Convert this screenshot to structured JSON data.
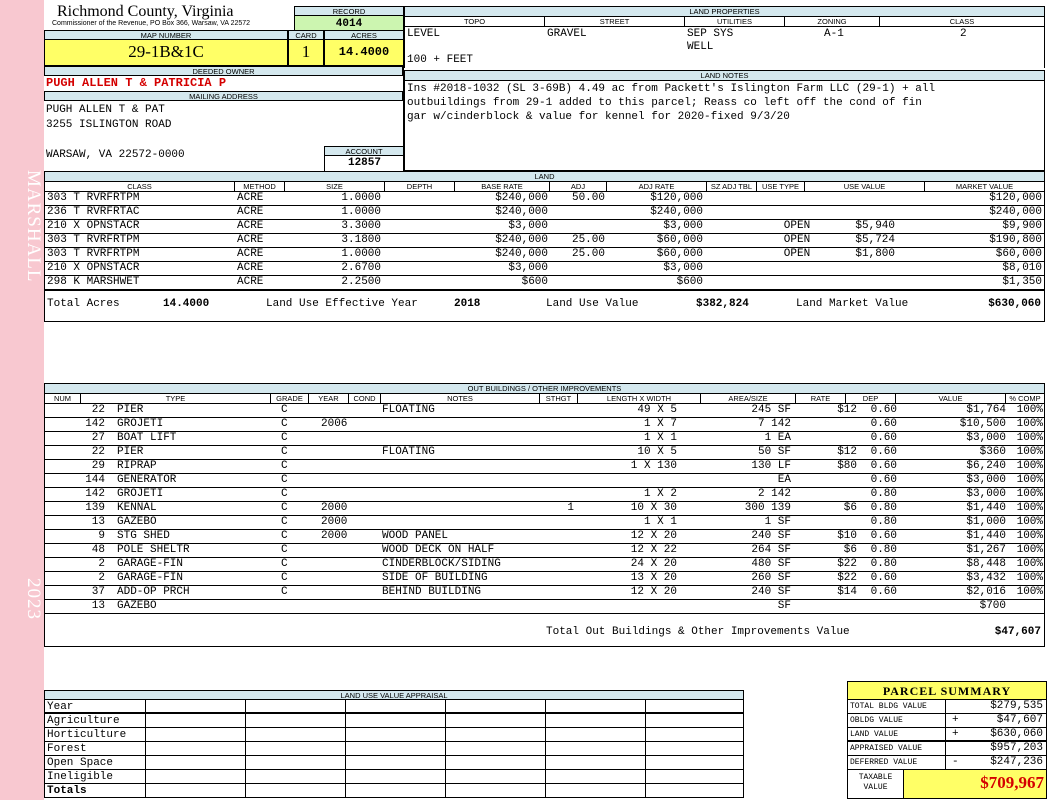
{
  "sidebar": {
    "area": "MARSHALL",
    "year": "2023"
  },
  "header": {
    "county": "Richmond County, Virginia",
    "subtitle": "Commissioner of the Revenue, PO Box 366, Warsaw, VA 22572",
    "record_label": "RECORD",
    "record": "4014",
    "map_number_label": "MAP NUMBER",
    "map_number": "29-1B&1C",
    "card_label": "CARD",
    "card": "1",
    "acres_label": "ACRES",
    "acres": "14.4000"
  },
  "owner": {
    "deeded_owner_label": "DEEDED OWNER",
    "name": "PUGH ALLEN T & PATRICIA P",
    "mailing_label": "MAILING ADDRESS",
    "address_lines": [
      "PUGH ALLEN T & PAT",
      "3255 ISLINGTON ROAD",
      "",
      "WARSAW, VA 22572-0000"
    ],
    "account_label": "ACCOUNT",
    "account": "12857"
  },
  "land_properties": {
    "title": "LAND PROPERTIES",
    "headers": [
      "TOPO",
      "STREET",
      "UTILITIES",
      "ZONING",
      "CLASS"
    ],
    "topo": [
      "LEVEL",
      "",
      "100 + FEET"
    ],
    "street": "GRAVEL",
    "utilities": [
      "SEP SYS",
      "WELL"
    ],
    "zoning": "A-1",
    "class": "2"
  },
  "land_notes": {
    "title": "LAND NOTES",
    "lines": [
      "Ins #2018-1032 (SL 3-69B) 4.49 ac from Packett's Islington Farm LLC (29-1) + all",
      "outbuildings from 29-1 added to this parcel; Reass co left off the cond of fin",
      "gar w/cinderblock & value for kennel for 2020-fixed 9/3/20"
    ]
  },
  "land": {
    "title": "LAND",
    "headers": [
      "CLASS",
      "METHOD",
      "SIZE",
      "DEPTH",
      "BASE RATE",
      "ADJ",
      "ADJ RATE",
      "SZ ADJ TBL",
      "USE TYPE",
      "USE VALUE",
      "MARKET VALUE"
    ],
    "rows": [
      [
        "303 T RVRFRTPM",
        "ACRE",
        "1.0000",
        "",
        "$240,000",
        "50.00",
        "$120,000",
        "",
        "",
        "",
        "$120,000"
      ],
      [
        "236 T RVRFRTAC",
        "ACRE",
        "1.0000",
        "",
        "$240,000",
        "",
        "$240,000",
        "",
        "",
        "",
        "$240,000"
      ],
      [
        "210 X OPNSTACR",
        "ACRE",
        "3.3000",
        "",
        "$3,000",
        "",
        "$3,000",
        "",
        "OPEN",
        "$5,940",
        "$9,900"
      ],
      [
        "303 T RVRFRTPM",
        "ACRE",
        "3.1800",
        "",
        "$240,000",
        "25.00",
        "$60,000",
        "",
        "OPEN",
        "$5,724",
        "$190,800"
      ],
      [
        "303 T RVRFRTPM",
        "ACRE",
        "1.0000",
        "",
        "$240,000",
        "25.00",
        "$60,000",
        "",
        "OPEN",
        "$1,800",
        "$60,000"
      ],
      [
        "210 X OPNSTACR",
        "ACRE",
        "2.6700",
        "",
        "$3,000",
        "",
        "$3,000",
        "",
        "",
        "",
        "$8,010"
      ],
      [
        "298 K MARSHWET",
        "ACRE",
        "2.2500",
        "",
        "$600",
        "",
        "$600",
        "",
        "",
        "",
        "$1,350"
      ]
    ],
    "totals": {
      "total_acres_label": "Total Acres",
      "total_acres": "14.4000",
      "effective_year_label": "Land Use Effective Year",
      "effective_year": "2018",
      "use_value_label": "Land Use Value",
      "use_value": "$382,824",
      "market_value_label": "Land Market Value",
      "market_value": "$630,060"
    }
  },
  "outbuildings": {
    "title": "OUT BUILDINGS / OTHER IMPROVEMENTS",
    "headers": [
      "NUM",
      "TYPE",
      "GRADE",
      "YEAR",
      "COND",
      "NOTES",
      "STHGT",
      "LENGTH X WIDTH",
      "AREA/SIZE",
      "RATE",
      "DEP",
      "VALUE",
      "% COMP"
    ],
    "rows": [
      [
        "22",
        "PIER",
        "C",
        "",
        "",
        "FLOATING",
        "",
        "49 X 5",
        "245 SF",
        "$12",
        "0.60",
        "$1,764",
        "100%"
      ],
      [
        "142",
        "GROJETI",
        "C",
        "2006",
        "",
        "",
        "",
        "1 X 7",
        "7 142",
        "",
        "0.60",
        "$10,500",
        "100%"
      ],
      [
        "27",
        "BOAT LIFT",
        "C",
        "",
        "",
        "",
        "",
        "1 X 1",
        "1 EA",
        "",
        "0.60",
        "$3,000",
        "100%"
      ],
      [
        "22",
        "PIER",
        "C",
        "",
        "",
        "FLOATING",
        "",
        "10 X 5",
        "50 SF",
        "$12",
        "0.60",
        "$360",
        "100%"
      ],
      [
        "29",
        "RIPRAP",
        "C",
        "",
        "",
        "",
        "",
        "1 X 130",
        "130 LF",
        "$80",
        "0.60",
        "$6,240",
        "100%"
      ],
      [
        "144",
        "GENERATOR",
        "C",
        "",
        "",
        "",
        "",
        "",
        "EA",
        "",
        "0.60",
        "$3,000",
        "100%"
      ],
      [
        "142",
        "GROJETI",
        "C",
        "",
        "",
        "",
        "",
        "1 X 2",
        "2 142",
        "",
        "0.80",
        "$3,000",
        "100%"
      ],
      [
        "139",
        "KENNAL",
        "C",
        "2000",
        "",
        "",
        "1",
        "10 X 30",
        "300 139",
        "$6",
        "0.80",
        "$1,440",
        "100%"
      ],
      [
        "13",
        "GAZEBO",
        "C",
        "2000",
        "",
        "",
        "",
        "1 X 1",
        "1 SF",
        "",
        "0.80",
        "$1,000",
        "100%"
      ],
      [
        "9",
        "STG SHED",
        "C",
        "2000",
        "",
        "WOOD PANEL",
        "",
        "12 X 20",
        "240 SF",
        "$10",
        "0.60",
        "$1,440",
        "100%"
      ],
      [
        "48",
        "POLE SHELTR",
        "C",
        "",
        "",
        "WOOD DECK ON HALF",
        "",
        "12 X 22",
        "264 SF",
        "$6",
        "0.80",
        "$1,267",
        "100%"
      ],
      [
        "2",
        "GARAGE-FIN",
        "C",
        "",
        "",
        "CINDERBLOCK/SIDING",
        "",
        "24 X 20",
        "480 SF",
        "$22",
        "0.80",
        "$8,448",
        "100%"
      ],
      [
        "2",
        "GARAGE-FIN",
        "C",
        "",
        "",
        "SIDE OF BUILDING",
        "",
        "13 X 20",
        "260 SF",
        "$22",
        "0.60",
        "$3,432",
        "100%"
      ],
      [
        "37",
        "ADD-OP PRCH",
        "C",
        "",
        "",
        "BEHIND BUILDING",
        "",
        "12 X 20",
        "240 SF",
        "$14",
        "0.60",
        "$2,016",
        "100%"
      ],
      [
        "13",
        "GAZEBO",
        "",
        "",
        "",
        "",
        "",
        "",
        "SF",
        "",
        "",
        "$700",
        ""
      ]
    ],
    "total_label": "Total Out Buildings & Other Improvements Value",
    "total": "$47,607"
  },
  "land_use_appraisal": {
    "title": "LAND USE VALUE APPRAISAL",
    "rows": [
      "Year",
      "Agriculture",
      "Horticulture",
      "Forest",
      "Open Space",
      "Ineligible",
      "Totals"
    ]
  },
  "parcel_summary": {
    "title": "PARCEL SUMMARY",
    "rows": [
      {
        "label": "TOTAL BLDG VALUE",
        "sign": "",
        "value": "$279,535"
      },
      {
        "label": "OBLDG VALUE",
        "sign": "+",
        "value": "$47,607"
      },
      {
        "label": "LAND VALUE",
        "sign": "+",
        "value": "$630,060"
      },
      {
        "label": "APPRAISED VALUE",
        "sign": "",
        "value": "$957,203"
      },
      {
        "label": "DEFERRED VALUE",
        "sign": "-",
        "value": "$247,236"
      }
    ],
    "taxable_label": "TAXABLE VALUE",
    "taxable": "$709,967"
  },
  "colors": {
    "yellow": "#ffff66",
    "green": "#ccf5b0",
    "header_blue": "#d4e8ee",
    "pink": "#f8c8d0",
    "red": "#d40000"
  }
}
